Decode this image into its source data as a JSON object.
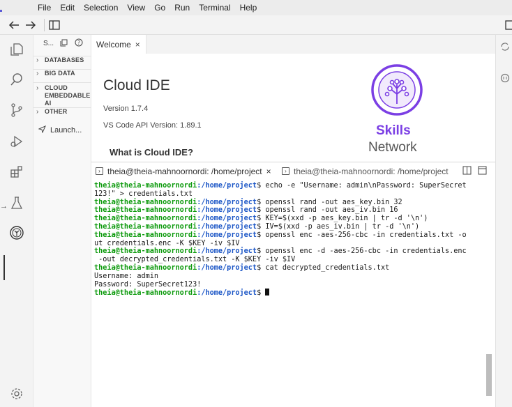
{
  "menu": [
    "File",
    "Edit",
    "Selection",
    "View",
    "Go",
    "Run",
    "Terminal",
    "Help"
  ],
  "toolbar": {
    "back_icon": "arrow-left-icon",
    "forward_icon": "arrow-right-icon",
    "layout_icon": "split-layout-icon"
  },
  "activity_bar": [
    {
      "name": "explorer",
      "icon": "files-icon"
    },
    {
      "name": "search",
      "icon": "search-icon"
    },
    {
      "name": "source-control",
      "icon": "source-control-icon"
    },
    {
      "name": "run-debug",
      "icon": "debug-icon"
    },
    {
      "name": "extensions",
      "icon": "extensions-icon"
    },
    {
      "name": "testing",
      "icon": "flask-icon"
    },
    {
      "name": "skills-network",
      "icon": "skills-network-icon"
    },
    {
      "name": "settings",
      "icon": "gear-icon"
    }
  ],
  "sidebar": {
    "title": "S...",
    "sections": [
      {
        "label": "DATABASES"
      },
      {
        "label": "BIG DATA"
      },
      {
        "label": "CLOUD EMBEDDABLE AI"
      },
      {
        "label": "OTHER"
      }
    ],
    "launch_item": "Launch..."
  },
  "editor_tab": {
    "label": "Welcome",
    "close": "×"
  },
  "welcome": {
    "title": "Cloud IDE",
    "version": "Version 1.7.4",
    "api_version": "VS Code API Version: 1.89.1",
    "what_heading": "What is Cloud IDE?",
    "brand_top": "Skills",
    "brand_bottom": "Network",
    "brand_color": "#7b3fe4"
  },
  "terminal_tabs": [
    {
      "label": "theia@theia-mahnoornordi: /home/project",
      "close": "×",
      "active": true
    },
    {
      "label": "theia@theia-mahnoornordi: /home/project",
      "active": false
    }
  ],
  "terminal": {
    "prompt_user": "theia@theia-mahnoornordi",
    "prompt_path": ":/home/project",
    "lines": [
      {
        "type": "cmd",
        "text": "$ echo -e \"Username: admin\\nPassword: SuperSecret"
      },
      {
        "type": "out",
        "text": "123!\" > credentials.txt"
      },
      {
        "type": "cmd",
        "text": "$ openssl rand -out aes_key.bin 32"
      },
      {
        "type": "cmd",
        "text": "$ openssl rand -out aes_iv.bin 16"
      },
      {
        "type": "cmd",
        "text": "$ KEY=$(xxd -p aes_key.bin | tr -d '\\n')"
      },
      {
        "type": "cmd",
        "text": "$ IV=$(xxd -p aes_iv.bin | tr -d '\\n')"
      },
      {
        "type": "cmd",
        "text": "$ openssl enc -aes-256-cbc -in credentials.txt -o"
      },
      {
        "type": "out",
        "text": "ut credentials.enc -K $KEY -iv $IV"
      },
      {
        "type": "cmd",
        "text": "$ openssl enc -d -aes-256-cbc -in credentials.enc"
      },
      {
        "type": "out",
        "text": " -out decrypted_credentials.txt -K $KEY -iv $IV"
      },
      {
        "type": "cmd",
        "text": "$ cat decrypted_credentials.txt"
      },
      {
        "type": "out",
        "text": "Username: admin"
      },
      {
        "type": "out",
        "text": "Password: SuperSecret123!"
      },
      {
        "type": "cmd",
        "text": "$ "
      }
    ],
    "prompt_user_color": "#0c9a0c",
    "prompt_path_color": "#1a55c6"
  }
}
